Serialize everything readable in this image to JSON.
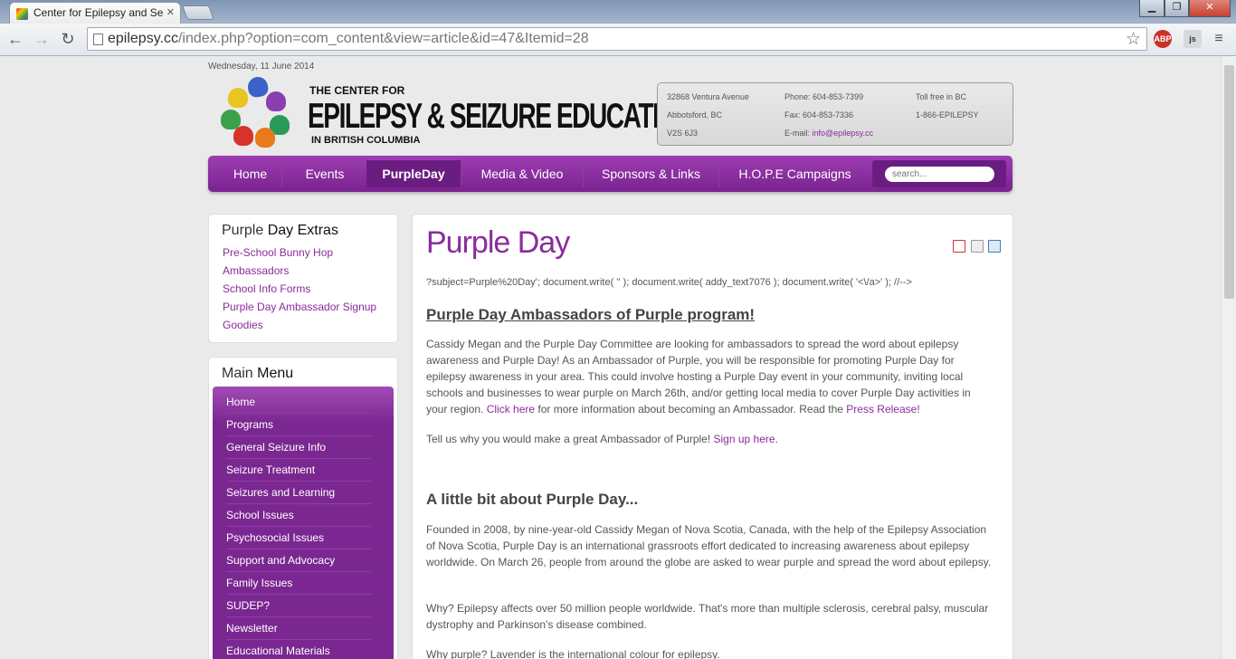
{
  "browser": {
    "tab_title": "Center for Epilepsy and Se",
    "url_host": "epilepsy.cc",
    "url_path": "/index.php?option=com_content&view=article&id=47&Itemid=28",
    "ext_abp": "ABP",
    "ext_js": "js"
  },
  "site": {
    "date": "Wednesday, 11 June 2014",
    "logo_line1": "THE CENTER FOR",
    "logo_line2": "EPILEPSY & SEIZURE EDUCATION",
    "logo_line3": "IN BRITISH COLUMBIA",
    "contact": {
      "address1": "32868 Ventura Avenue",
      "address2": "Abbotsford, BC",
      "address3": "V2S 6J3",
      "phone": "Phone: 604-853-7399",
      "fax": "Fax: 604-853-7336",
      "email_label": "E-mail:",
      "email": "info@epilepsy.cc",
      "tollfree_label": "Toll free in BC",
      "tollfree": "1-866-EPILEPSY"
    }
  },
  "nav": {
    "items": [
      "Home",
      "Events",
      "PurpleDay",
      "Media & Video",
      "Sponsors & Links",
      "H.O.P.E Campaigns"
    ],
    "search_placeholder": "search..."
  },
  "extras": {
    "title_a": "Purple",
    "title_b": "Day Extras",
    "links": [
      "Pre-School Bunny Hop",
      "Ambassadors",
      "School Info Forms",
      "Purple Day Ambassador Signup",
      "Goodies"
    ]
  },
  "mainmenu": {
    "title_a": "Main",
    "title_b": "Menu",
    "links": [
      "Home",
      "Programs",
      "General Seizure Info",
      "Seizure Treatment",
      "Seizures and Learning",
      "School Issues",
      "Psychosocial Issues",
      "Support and Advocacy",
      "Family Issues",
      "SUDEP?",
      "Newsletter",
      "Educational Materials"
    ]
  },
  "article": {
    "title": "Purple Day",
    "script_line": "?subject=Purple%20Day'; document.write( '' ); document.write( addy_text7076 ); document.write( '<\\/a>' ); //-->",
    "h_ambassadors": "Purple Day Ambassadors of Purple program!",
    "p1": "Cassidy Megan and the Purple Day Committee are looking for ambassadors to spread the word about epilepsy awareness and Purple Day! As an Ambassador of Purple, you will be responsible for promoting Purple Day for epilepsy awareness in your area. This could involve hosting a Purple Day event in your community, inviting local schools and businesses to wear purple on March 26th, and/or getting local media to cover Purple Day activities in your region.",
    "p1_link": "Click here",
    "p1_mid": "for more information about becoming an Ambassador. Read the",
    "p1_link2": "Press Release!",
    "p2": "Tell us why you would make a great Ambassador of Purple!",
    "p2_link": "Sign up here.",
    "h_about": "A little bit about Purple Day...",
    "p3": "Founded in 2008, by nine-year-old Cassidy Megan of Nova Scotia, Canada, with the help of the Epilepsy Association of Nova Scotia, Purple Day is an international grassroots effort dedicated to increasing awareness about epilepsy worldwide. On March 26, people from around the globe are asked to wear purple and spread the word about epilepsy.",
    "p4": "Why? Epilepsy affects over 50 million people worldwide. That's more than multiple sclerosis, cerebral palsy, muscular dystrophy and Parkinson's disease combined.",
    "p5": "Why purple? Lavender is the international colour for epilepsy."
  },
  "colors": {
    "brand_purple": "#8a2c9c",
    "nav_purple": "#7a2290"
  }
}
